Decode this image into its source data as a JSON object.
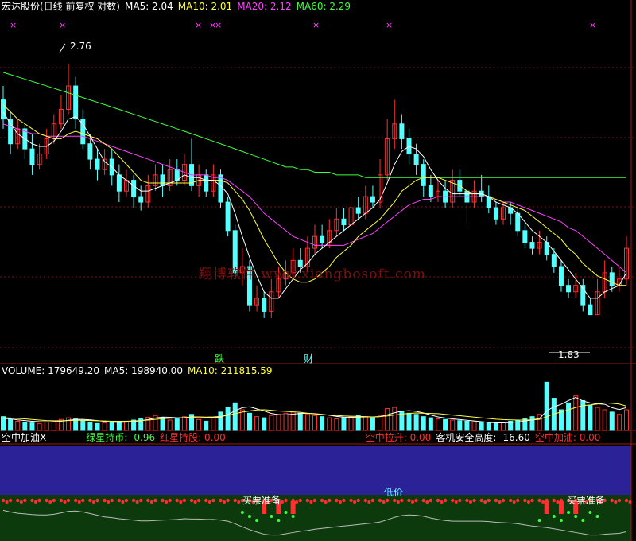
{
  "title": {
    "stock": "宏达股份(日线 前复权 对数)",
    "ma5": "MA5: 2.04",
    "ma10": "MA10: 2.01",
    "ma20": "MA20: 2.12",
    "ma60": "MA60: 2.29"
  },
  "annotations": {
    "high": "2.76",
    "low": "1.83",
    "marker_drop": "跌",
    "marker_fin": "财",
    "watermark": "翔博软件 www.xiangbosoft.com"
  },
  "volume_header": {
    "volume": "VOLUME: 179649.20",
    "ma5": "MA5: 198940.00",
    "ma10": "MA10: 211815.59"
  },
  "indicator_header": {
    "name": "空中加油X",
    "green": "绿星持币: -0.96",
    "red": "红星持股: 0.00",
    "pull": "空中拉升: 0.00",
    "safe": "客机安全高度: -16.60",
    "refuel": "空中加油: 0.00"
  },
  "indicator_labels": {
    "buy1": "买票准备",
    "buy2": "低价",
    "buy3": "买票准备"
  },
  "colors": {
    "up": "#ff3030",
    "down": "#54ffff",
    "ma5": "#ffffff",
    "ma10": "#ffff40",
    "ma20": "#ff40ff",
    "ma60": "#40ff40",
    "grid": "#7a1414",
    "indicator_sky": "#2a2296",
    "indicator_ground": "#0c3a0c"
  },
  "chart_data": {
    "type": "candlestick",
    "scale": "log",
    "ylim": [
      1.75,
      2.85
    ],
    "candles": [
      [
        2.6,
        2.52,
        2.66,
        2.48
      ],
      [
        2.52,
        2.42,
        2.55,
        2.38
      ],
      [
        2.42,
        2.48,
        2.52,
        2.4
      ],
      [
        2.48,
        2.4,
        2.5,
        2.36
      ],
      [
        2.4,
        2.34,
        2.46,
        2.3
      ],
      [
        2.34,
        2.38,
        2.42,
        2.32
      ],
      [
        2.38,
        2.44,
        2.48,
        2.36
      ],
      [
        2.44,
        2.5,
        2.54,
        2.42
      ],
      [
        2.5,
        2.56,
        2.62,
        2.48
      ],
      [
        2.56,
        2.66,
        2.76,
        2.54
      ],
      [
        2.66,
        2.52,
        2.7,
        2.48
      ],
      [
        2.52,
        2.42,
        2.56,
        2.4
      ],
      [
        2.42,
        2.36,
        2.46,
        2.32
      ],
      [
        2.36,
        2.32,
        2.4,
        2.28
      ],
      [
        2.32,
        2.36,
        2.4,
        2.3
      ],
      [
        2.36,
        2.3,
        2.4,
        2.26
      ],
      [
        2.3,
        2.24,
        2.34,
        2.2
      ],
      [
        2.24,
        2.28,
        2.32,
        2.22
      ],
      [
        2.28,
        2.22,
        2.3,
        2.18
      ],
      [
        2.22,
        2.2,
        2.26,
        2.17
      ],
      [
        2.2,
        2.26,
        2.3,
        2.18
      ],
      [
        2.26,
        2.3,
        2.34,
        2.24
      ],
      [
        2.3,
        2.26,
        2.34,
        2.22
      ],
      [
        2.26,
        2.32,
        2.36,
        2.24
      ],
      [
        2.32,
        2.28,
        2.36,
        2.26
      ],
      [
        2.28,
        2.34,
        2.38,
        2.26
      ],
      [
        2.34,
        2.26,
        2.44,
        2.24
      ],
      [
        2.26,
        2.3,
        2.34,
        2.22
      ],
      [
        2.3,
        2.24,
        2.32,
        2.22
      ],
      [
        2.24,
        2.3,
        2.34,
        2.22
      ],
      [
        2.3,
        2.2,
        2.32,
        2.18
      ],
      [
        2.2,
        2.1,
        2.22,
        2.08
      ],
      [
        2.1,
        1.96,
        2.12,
        1.94
      ],
      [
        1.96,
        1.98,
        2.04,
        1.92
      ],
      [
        1.98,
        1.86,
        2.0,
        1.84
      ],
      [
        1.86,
        1.88,
        1.92,
        1.84
      ],
      [
        1.88,
        1.84,
        1.9,
        1.82
      ],
      [
        1.84,
        1.9,
        1.94,
        1.82
      ],
      [
        1.9,
        1.94,
        1.98,
        1.88
      ],
      [
        1.94,
        1.96,
        2.0,
        1.92
      ],
      [
        1.96,
        2.0,
        2.04,
        1.94
      ],
      [
        2.0,
        1.98,
        2.04,
        1.96
      ],
      [
        1.98,
        2.04,
        2.08,
        1.96
      ],
      [
        2.04,
        2.08,
        2.12,
        2.02
      ],
      [
        2.08,
        2.06,
        2.12,
        2.04
      ],
      [
        2.06,
        2.1,
        2.14,
        2.04
      ],
      [
        2.1,
        2.14,
        2.18,
        2.08
      ],
      [
        2.14,
        2.12,
        2.18,
        2.1
      ],
      [
        2.12,
        2.18,
        2.22,
        2.1
      ],
      [
        2.18,
        2.16,
        2.22,
        2.14
      ],
      [
        2.16,
        2.22,
        2.26,
        2.14
      ],
      [
        2.22,
        2.2,
        2.26,
        2.18
      ],
      [
        2.2,
        2.3,
        2.36,
        2.18
      ],
      [
        2.3,
        2.44,
        2.52,
        2.28
      ],
      [
        2.44,
        2.5,
        2.6,
        2.4
      ],
      [
        2.5,
        2.44,
        2.54,
        2.4
      ],
      [
        2.44,
        2.38,
        2.48,
        2.34
      ],
      [
        2.38,
        2.34,
        2.42,
        2.3
      ],
      [
        2.34,
        2.26,
        2.36,
        2.22
      ],
      [
        2.26,
        2.22,
        2.3,
        2.2
      ],
      [
        2.22,
        2.24,
        2.28,
        2.2
      ],
      [
        2.24,
        2.2,
        2.28,
        2.18
      ],
      [
        2.2,
        2.28,
        2.32,
        2.18
      ],
      [
        2.28,
        2.24,
        2.32,
        2.22
      ],
      [
        2.24,
        2.2,
        2.28,
        2.12
      ],
      [
        2.2,
        2.24,
        2.28,
        2.18
      ],
      [
        2.24,
        2.22,
        2.3,
        2.2
      ],
      [
        2.22,
        2.18,
        2.26,
        2.16
      ],
      [
        2.18,
        2.14,
        2.2,
        2.12
      ],
      [
        2.14,
        2.18,
        2.2,
        2.12
      ],
      [
        2.18,
        2.16,
        2.2,
        2.12
      ],
      [
        2.16,
        2.1,
        2.18,
        2.08
      ],
      [
        2.1,
        2.06,
        2.12,
        2.04
      ],
      [
        2.06,
        2.04,
        2.08,
        2.02
      ],
      [
        2.04,
        2.06,
        2.1,
        2.02
      ],
      [
        2.06,
        2.02,
        2.08,
        2.0
      ],
      [
        2.02,
        1.98,
        2.04,
        1.96
      ],
      [
        1.98,
        1.92,
        2.0,
        1.9
      ],
      [
        1.92,
        1.9,
        1.94,
        1.88
      ],
      [
        1.9,
        1.92,
        1.96,
        1.88
      ],
      [
        1.92,
        1.86,
        1.94,
        1.84
      ],
      [
        1.86,
        1.83,
        1.88,
        1.83
      ],
      [
        1.83,
        1.9,
        1.94,
        1.83
      ],
      [
        1.9,
        1.96,
        2.0,
        1.88
      ],
      [
        1.96,
        1.92,
        1.98,
        1.9
      ],
      [
        1.92,
        1.94,
        1.98,
        1.9
      ],
      [
        1.94,
        2.04,
        2.08,
        1.92
      ]
    ],
    "ma5": [
      2.55,
      2.5,
      2.46,
      2.44,
      2.42,
      2.41,
      2.41,
      2.43,
      2.47,
      2.52,
      2.53,
      2.5,
      2.45,
      2.4,
      2.35,
      2.33,
      2.3,
      2.28,
      2.26,
      2.24,
      2.24,
      2.25,
      2.26,
      2.27,
      2.28,
      2.3,
      2.29,
      2.29,
      2.28,
      2.28,
      2.26,
      2.23,
      2.16,
      2.08,
      2.01,
      1.95,
      1.9,
      1.88,
      1.88,
      1.91,
      1.94,
      1.97,
      1.99,
      2.02,
      2.04,
      2.06,
      2.08,
      2.1,
      2.12,
      2.14,
      2.16,
      2.18,
      2.21,
      2.27,
      2.34,
      2.39,
      2.41,
      2.4,
      2.37,
      2.32,
      2.28,
      2.25,
      2.23,
      2.23,
      2.23,
      2.23,
      2.23,
      2.22,
      2.2,
      2.19,
      2.18,
      2.16,
      2.13,
      2.1,
      2.08,
      2.06,
      2.03,
      2.0,
      1.97,
      1.94,
      1.91,
      1.88,
      1.88,
      1.9,
      1.91,
      1.92,
      1.96
    ],
    "ma10": [
      2.58,
      2.55,
      2.52,
      2.5,
      2.48,
      2.46,
      2.45,
      2.44,
      2.44,
      2.46,
      2.47,
      2.46,
      2.45,
      2.44,
      2.42,
      2.4,
      2.37,
      2.34,
      2.31,
      2.28,
      2.27,
      2.27,
      2.27,
      2.27,
      2.27,
      2.27,
      2.27,
      2.28,
      2.28,
      2.28,
      2.28,
      2.27,
      2.24,
      2.21,
      2.17,
      2.12,
      2.07,
      2.03,
      1.99,
      1.96,
      1.94,
      1.93,
      1.93,
      1.94,
      1.96,
      1.98,
      2.01,
      2.03,
      2.05,
      2.08,
      2.1,
      2.12,
      2.14,
      2.17,
      2.2,
      2.24,
      2.26,
      2.28,
      2.29,
      2.29,
      2.29,
      2.28,
      2.27,
      2.26,
      2.24,
      2.23,
      2.23,
      2.22,
      2.21,
      2.2,
      2.19,
      2.18,
      2.17,
      2.15,
      2.13,
      2.11,
      2.09,
      2.07,
      2.04,
      2.02,
      1.99,
      1.97,
      1.95,
      1.94,
      1.93,
      1.92,
      1.92
    ],
    "ma20": [
      2.5,
      2.49,
      2.48,
      2.47,
      2.46,
      2.46,
      2.45,
      2.45,
      2.45,
      2.45,
      2.45,
      2.45,
      2.44,
      2.43,
      2.42,
      2.41,
      2.4,
      2.39,
      2.38,
      2.37,
      2.36,
      2.35,
      2.34,
      2.33,
      2.32,
      2.31,
      2.3,
      2.3,
      2.3,
      2.29,
      2.29,
      2.28,
      2.26,
      2.24,
      2.22,
      2.19,
      2.16,
      2.14,
      2.12,
      2.1,
      2.08,
      2.07,
      2.06,
      2.05,
      2.05,
      2.05,
      2.05,
      2.05,
      2.06,
      2.07,
      2.08,
      2.09,
      2.11,
      2.13,
      2.15,
      2.17,
      2.19,
      2.2,
      2.21,
      2.21,
      2.22,
      2.22,
      2.22,
      2.22,
      2.22,
      2.22,
      2.22,
      2.22,
      2.21,
      2.2,
      2.2,
      2.19,
      2.18,
      2.17,
      2.16,
      2.15,
      2.14,
      2.13,
      2.11,
      2.1,
      2.08,
      2.06,
      2.04,
      2.02,
      2.0,
      1.98,
      1.96
    ],
    "ma60": [
      2.72,
      2.71,
      2.7,
      2.69,
      2.68,
      2.67,
      2.66,
      2.65,
      2.64,
      2.63,
      2.62,
      2.61,
      2.6,
      2.59,
      2.58,
      2.57,
      2.56,
      2.55,
      2.54,
      2.53,
      2.52,
      2.51,
      2.5,
      2.49,
      2.48,
      2.47,
      2.46,
      2.45,
      2.44,
      2.43,
      2.42,
      2.41,
      2.4,
      2.39,
      2.38,
      2.37,
      2.36,
      2.35,
      2.34,
      2.33,
      2.33,
      2.32,
      2.32,
      2.31,
      2.31,
      2.31,
      2.3,
      2.3,
      2.3,
      2.3,
      2.29,
      2.29,
      2.29,
      2.29,
      2.29,
      2.29,
      2.29,
      2.29,
      2.29,
      2.29,
      2.29,
      2.29,
      2.29,
      2.29,
      2.29,
      2.29,
      2.29,
      2.29,
      2.29,
      2.29,
      2.29,
      2.29,
      2.29,
      2.29,
      2.29,
      2.29,
      2.29,
      2.29,
      2.29,
      2.29,
      2.29,
      2.29,
      2.29,
      2.29,
      2.29,
      2.29,
      2.29
    ],
    "volume": [
      120,
      95,
      80,
      70,
      65,
      60,
      72,
      80,
      95,
      110,
      100,
      85,
      70,
      60,
      65,
      70,
      75,
      80,
      90,
      100,
      115,
      130,
      110,
      90,
      100,
      120,
      140,
      95,
      80,
      110,
      160,
      200,
      240,
      180,
      150,
      120,
      110,
      130,
      140,
      150,
      160,
      150,
      140,
      130,
      120,
      110,
      100,
      110,
      120,
      130,
      120,
      110,
      130,
      190,
      200,
      170,
      150,
      140,
      120,
      110,
      100,
      95,
      90,
      85,
      80,
      75,
      70,
      65,
      60,
      70,
      80,
      90,
      100,
      120,
      140,
      420,
      280,
      180,
      240,
      300,
      260,
      220,
      200,
      180,
      160,
      140,
      179.6
    ],
    "volume_ma5": [
      105,
      100,
      92,
      86,
      80,
      76,
      74,
      75,
      80,
      88,
      95,
      96,
      92,
      86,
      78,
      72,
      70,
      72,
      78,
      84,
      94,
      108,
      116,
      114,
      110,
      112,
      118,
      118,
      114,
      112,
      116,
      138,
      172,
      198,
      206,
      188,
      170,
      148,
      138,
      136,
      142,
      148,
      150,
      146,
      140,
      132,
      122,
      116,
      114,
      116,
      118,
      118,
      120,
      136,
      154,
      168,
      172,
      166,
      152,
      134,
      118,
      108,
      100,
      94,
      88,
      82,
      76,
      70,
      66,
      66,
      68,
      74,
      82,
      92,
      104,
      170,
      206,
      228,
      260,
      288,
      256,
      240,
      232,
      228,
      198,
      182,
      198.9
    ],
    "volume_ma10": [
      110,
      108,
      104,
      100,
      95,
      90,
      86,
      84,
      84,
      86,
      88,
      88,
      86,
      84,
      82,
      80,
      80,
      80,
      82,
      86,
      90,
      96,
      102,
      106,
      108,
      110,
      114,
      116,
      116,
      118,
      122,
      132,
      146,
      160,
      170,
      178,
      180,
      176,
      170,
      166,
      162,
      158,
      150,
      144,
      138,
      134,
      130,
      126,
      124,
      122,
      120,
      118,
      120,
      126,
      134,
      142,
      148,
      152,
      150,
      148,
      146,
      140,
      134,
      128,
      122,
      116,
      110,
      104,
      98,
      94,
      92,
      90,
      90,
      92,
      96,
      120,
      144,
      160,
      180,
      200,
      216,
      222,
      230,
      240,
      236,
      230,
      211.8
    ]
  }
}
